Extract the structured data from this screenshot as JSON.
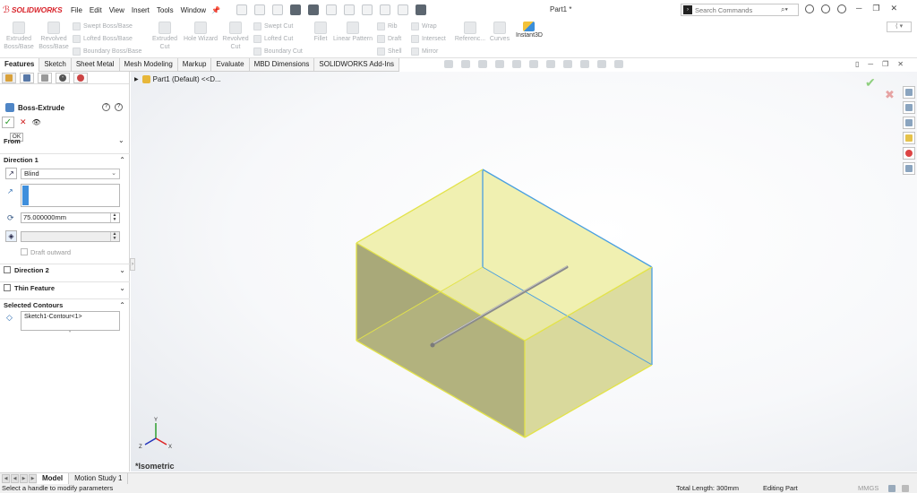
{
  "app": {
    "logo_brand": "SOLIDWORKS",
    "document_title": "Part1 *",
    "menus": [
      "File",
      "Edit",
      "View",
      "Insert",
      "Tools",
      "Window"
    ],
    "search_placeholder": "Search Commands"
  },
  "command_manager": {
    "extruded_boss": "Extruded Boss/Base",
    "revolved_boss": "Revolved Boss/Base",
    "swept_boss": "Swept Boss/Base",
    "lofted_boss": "Lofted Boss/Base",
    "boundary_boss": "Boundary Boss/Base",
    "extruded_cut": "Extruded Cut",
    "hole_wizard": "Hole Wizard",
    "revolved_cut": "Revolved Cut",
    "swept_cut": "Swept Cut",
    "lofted_cut": "Lofted Cut",
    "boundary_cut": "Boundary Cut",
    "fillet": "Fillet",
    "linear_pattern": "Linear Pattern",
    "rib": "Rib",
    "draft": "Draft",
    "shell": "Shell",
    "wrap": "Wrap",
    "intersect": "Intersect",
    "mirror": "Mirror",
    "reference": "Referenc...",
    "curves": "Curves",
    "instant3d": "Instant3D"
  },
  "tabs": [
    "Features",
    "Sketch",
    "Sheet Metal",
    "Mesh Modeling",
    "Markup",
    "Evaluate",
    "MBD Dimensions",
    "SOLIDWORKS Add-Ins"
  ],
  "property_manager": {
    "title": "Boss-Extrude",
    "ok_tooltip": "OK",
    "from_label": "From",
    "direction1": {
      "label": "Direction 1",
      "end_condition": "Blind",
      "depth": "75.000000mm",
      "draft_outward": "Draft outward"
    },
    "direction2_label": "Direction 2",
    "thin_feature_label": "Thin Feature",
    "selected_contours": {
      "label": "Selected Contours",
      "items": [
        "Sketch1-Contour<1>"
      ]
    }
  },
  "graphics": {
    "tree_root": "Part1  (Default) <<D...",
    "view_name": "*Isometric",
    "axes": {
      "x": "X",
      "y": "Y",
      "z": "Z"
    }
  },
  "bottom_tabs": [
    "Model",
    "Motion Study 1"
  ],
  "status": {
    "message": "Select a handle to modify parameters",
    "total_length": "Total Length: 300mm",
    "mode": "Editing Part",
    "units": "MMGS"
  },
  "colors": {
    "brand": "#d9272e",
    "face_fill": "#e9e99a",
    "edge_yellow": "#e3e34a",
    "edge_blue": "#4a9fe0",
    "accent": "#3f8fdc"
  }
}
